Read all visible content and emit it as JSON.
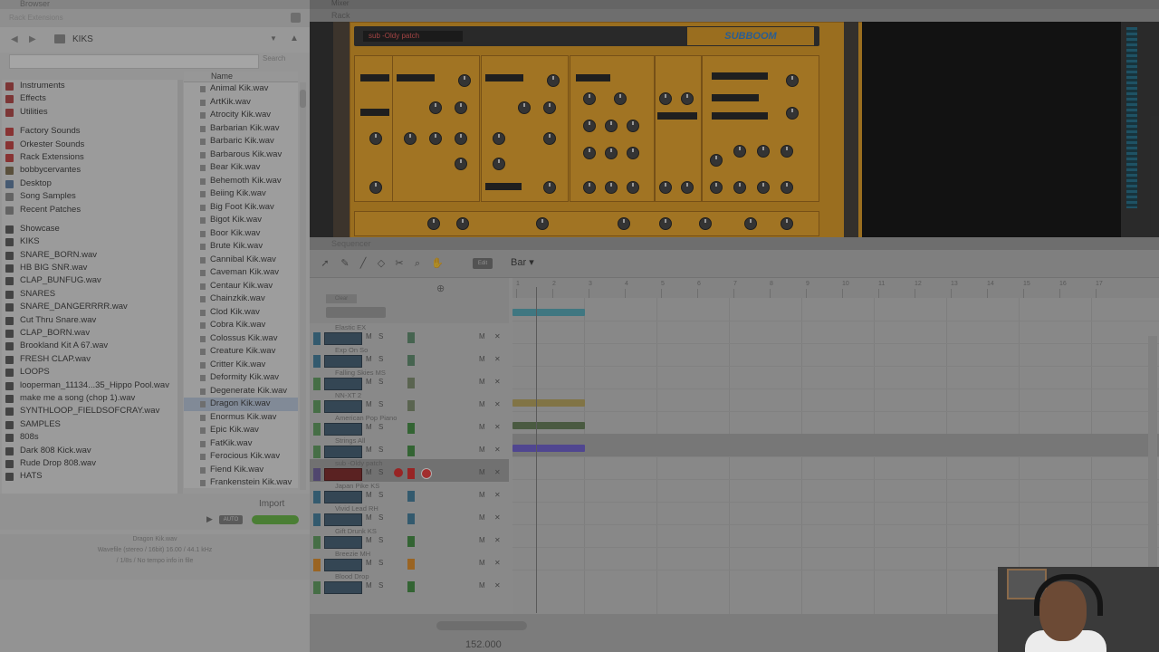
{
  "browser": {
    "title": "Browser",
    "subtitle": "Rack Extensions",
    "path": "KIKS",
    "search_placeholder": "",
    "search_button": "Search",
    "column_name": "Name",
    "locations": [
      {
        "label": "Instruments",
        "color": "#b04040",
        "gap": false
      },
      {
        "label": "Effects",
        "color": "#b04040",
        "gap": false
      },
      {
        "label": "Utilities",
        "color": "#b04040",
        "gap": false
      },
      {
        "label": "Factory Sounds",
        "color": "#c43a3a",
        "gap": true
      },
      {
        "label": "Orkester Sounds",
        "color": "#c43a3a",
        "gap": false
      },
      {
        "label": "Rack Extensions",
        "color": "#c43a3a",
        "gap": false
      },
      {
        "label": "bobbycervantes",
        "color": "#7a6a4a",
        "gap": false
      },
      {
        "label": "Desktop",
        "color": "#5a7aa0",
        "gap": false
      },
      {
        "label": "Song Samples",
        "color": "#888888",
        "gap": false
      },
      {
        "label": "Recent Patches",
        "color": "#888888",
        "gap": false
      },
      {
        "label": "Showcase",
        "color": "#555555",
        "gap": true
      },
      {
        "label": "KIKS",
        "color": "#555555",
        "gap": false
      },
      {
        "label": "SNARE_BORN.wav",
        "color": "#555555",
        "gap": false
      },
      {
        "label": "HB BIG SNR.wav",
        "color": "#555555",
        "gap": false
      },
      {
        "label": "CLAP_BUNFUG.wav",
        "color": "#555555",
        "gap": false
      },
      {
        "label": "SNARES",
        "color": "#555555",
        "gap": false
      },
      {
        "label": "SNARE_DANGERRRR.wav",
        "color": "#555555",
        "gap": false
      },
      {
        "label": "Cut Thru Snare.wav",
        "color": "#555555",
        "gap": false
      },
      {
        "label": "CLAP_BORN.wav",
        "color": "#555555",
        "gap": false
      },
      {
        "label": "Brookland Kit A 67.wav",
        "color": "#555555",
        "gap": false
      },
      {
        "label": "FRESH CLAP.wav",
        "color": "#555555",
        "gap": false
      },
      {
        "label": "LOOPS",
        "color": "#555555",
        "gap": false
      },
      {
        "label": "looperman_11134...35_Hippo Pool.wav",
        "color": "#555555",
        "gap": false
      },
      {
        "label": "make me a song (chop 1).wav",
        "color": "#555555",
        "gap": false
      },
      {
        "label": "SYNTHLOOP_FIELDSOFCRAY.wav",
        "color": "#555555",
        "gap": false
      },
      {
        "label": "SAMPLES",
        "color": "#555555",
        "gap": false
      },
      {
        "label": "808s",
        "color": "#555555",
        "gap": false
      },
      {
        "label": "Dark 808 Kick.wav",
        "color": "#555555",
        "gap": false
      },
      {
        "label": "Rude Drop 808.wav",
        "color": "#555555",
        "gap": false
      },
      {
        "label": "HATS",
        "color": "#555555",
        "gap": false
      }
    ],
    "files": [
      "Animal Kik.wav",
      "ArtKik.wav",
      "Atrocity Kik.wav",
      "Barbarian Kik.wav",
      "Barbaric Kik.wav",
      "Barbarous Kik.wav",
      "Bear Kik.wav",
      "Behemoth Kik.wav",
      "Beiing Kik.wav",
      "Big Foot Kik.wav",
      "Bigot Kik.wav",
      "Boor Kik.wav",
      "Brute Kik.wav",
      "Cannibal Kik.wav",
      "Caveman Kik.wav",
      "Centaur Kik.wav",
      "Chainzkik.wav",
      "Clod Kik.wav",
      "Cobra Kik.wav",
      "Colossus Kik.wav",
      "Creature Kik.wav",
      "Critter Kik.wav",
      "Deformity Kik.wav",
      "Degenerate Kik.wav",
      "Dragon Kik.wav",
      "Enormus Kik.wav",
      "Epic Kik.wav",
      "FatKik.wav",
      "Ferocious Kik.wav",
      "Fiend Kik.wav",
      "Frankenstein Kik.wav"
    ],
    "selected_file": "Dragon Kik.wav",
    "import_label": "Import",
    "auto_label": "AUTO",
    "preview_name": "Dragon Kik.wav",
    "preview_info_1": "Wavefile (stereo / 16bit) 16.00 / 44.1 kHz",
    "preview_info_2": "/ 1/8s / No tempo info in file"
  },
  "rack": {
    "window_title": "Mixer",
    "title": "Rack",
    "patch_name": "sub -Oldy patch",
    "logo_text": "SUBBOOM"
  },
  "sequencer": {
    "title": "Sequencer",
    "snap_value": "Bar",
    "edit_label": "Edit",
    "hdr_btn": "Clear",
    "tempo": "152.000",
    "ruler": [
      "1",
      "2",
      "3",
      "4",
      "5",
      "6",
      "7",
      "8",
      "9",
      "10",
      "11",
      "12",
      "13",
      "14",
      "15",
      "16",
      "17"
    ],
    "tracks": [
      {
        "name": "Elastic EX",
        "stripe": "#3a7a9a",
        "meter": "#5a8a6a",
        "selected": false
      },
      {
        "name": "Exp On So",
        "stripe": "#3a7a9a",
        "meter": "#5a8a6a",
        "selected": false
      },
      {
        "name": "Falling Skies MS",
        "stripe": "#5a9a5a",
        "meter": "#7a8a6a",
        "selected": false
      },
      {
        "name": "NN-XT 2",
        "stripe": "#5a9a5a",
        "meter": "#7a8a6a",
        "selected": false
      },
      {
        "name": "American Pop Piano",
        "stripe": "#5a9a5a",
        "meter": "#3a8a3a",
        "selected": false
      },
      {
        "name": "Strings All",
        "stripe": "#5a9a5a",
        "meter": "#3a8a3a",
        "selected": false
      },
      {
        "name": "sub -Oldy patch",
        "stripe": "#6a5a9a",
        "meter": "#d22",
        "selected": true
      },
      {
        "name": "Japan Pike KS",
        "stripe": "#3a7a9a",
        "meter": "#3a7a9a",
        "selected": false
      },
      {
        "name": "Vivid Lead RH",
        "stripe": "#3a7a9a",
        "meter": "#3a7a9a",
        "selected": false
      },
      {
        "name": "Gift Drunk KS",
        "stripe": "#5a9a5a",
        "meter": "#3a8a3a",
        "selected": false
      },
      {
        "name": "Breezie MH",
        "stripe": "#e08a20",
        "meter": "#e08a20",
        "selected": false
      },
      {
        "name": "Blood Drop",
        "stripe": "#5a9a5a",
        "meter": "#3a8a3a",
        "selected": false
      }
    ]
  }
}
